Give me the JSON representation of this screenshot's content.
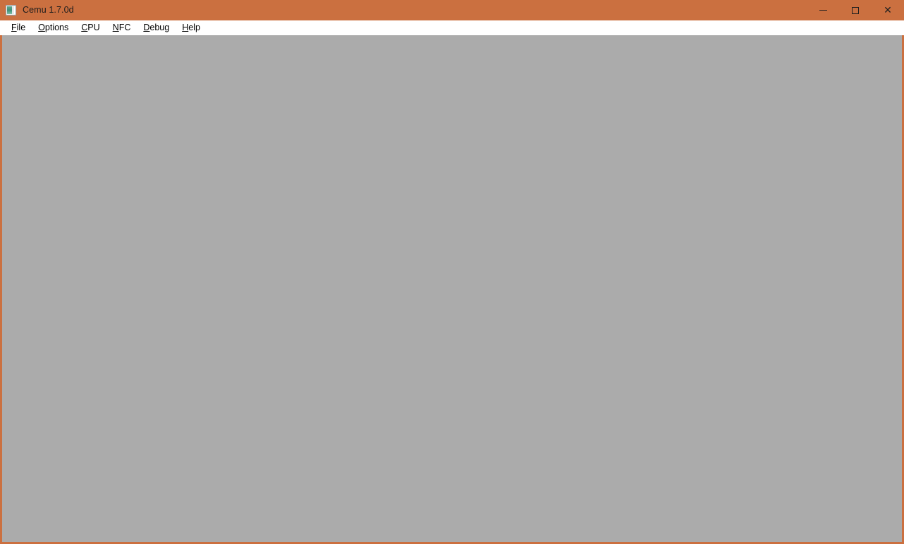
{
  "window": {
    "title": "Cemu 1.7.0d",
    "icon": "cemu-app-icon",
    "accent_color": "#cb7040",
    "titlebar_text_color": "#1c1c1c",
    "controls": [
      {
        "name": "minimize",
        "glyph": "—",
        "tooltip": "Minimize"
      },
      {
        "name": "maximize",
        "glyph": "□",
        "tooltip": "Maximize"
      },
      {
        "name": "close",
        "glyph": "✕",
        "tooltip": "Close"
      }
    ]
  },
  "menubar": {
    "items": [
      {
        "label": "File",
        "accel": "F",
        "rest": "ile"
      },
      {
        "label": "Options",
        "accel": "O",
        "rest": "ptions"
      },
      {
        "label": "CPU",
        "accel": "C",
        "rest": "PU"
      },
      {
        "label": "NFC",
        "accel": "N",
        "rest": "FC"
      },
      {
        "label": "Debug",
        "accel": "D",
        "rest": "ebug"
      },
      {
        "label": "Help",
        "accel": "H",
        "rest": "elp"
      }
    ]
  },
  "content": {
    "name": "emulator-render-area",
    "background_color": "#ababab",
    "text": ""
  }
}
